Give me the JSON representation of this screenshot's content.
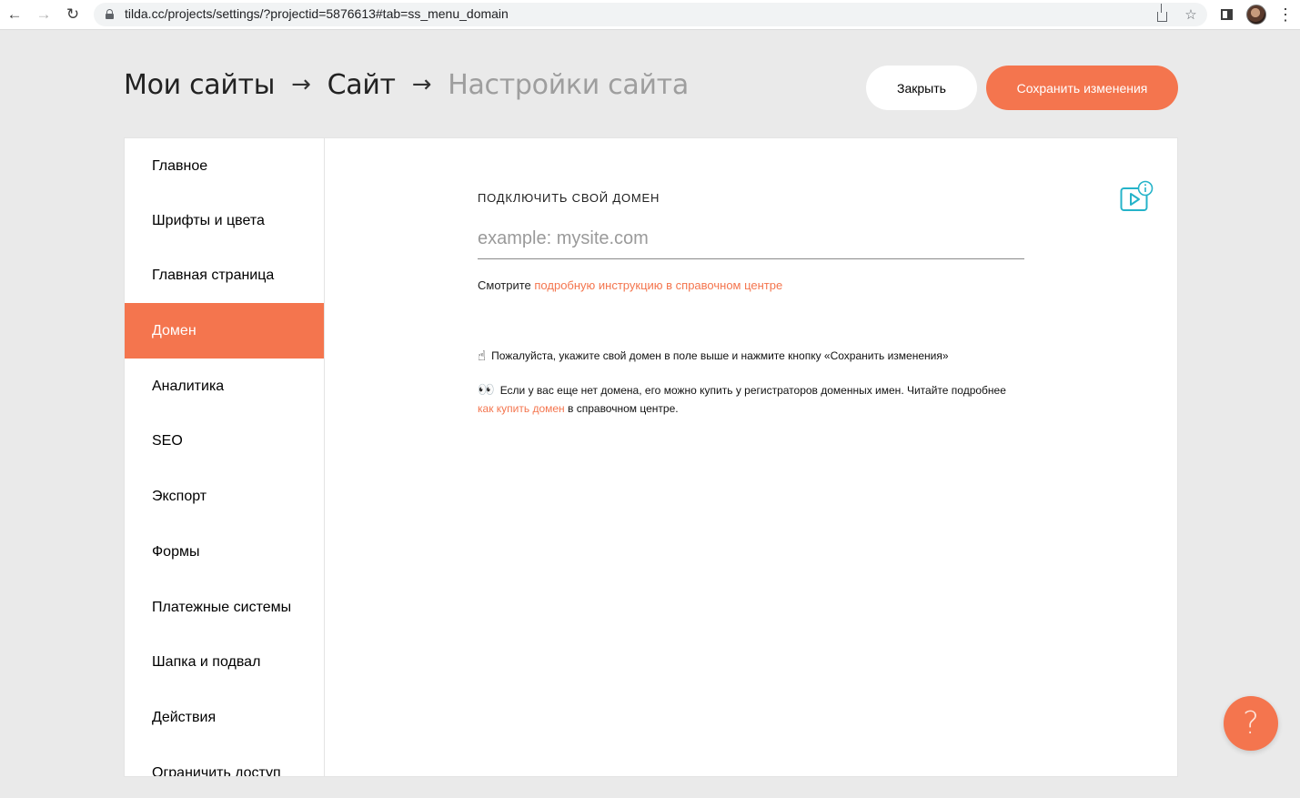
{
  "browser": {
    "url": "tilda.cc/projects/settings/?projectid=5876613#tab=ss_menu_domain",
    "icons": [
      "back-arrow-icon",
      "forward-arrow-icon",
      "reload-icon",
      "lock-icon",
      "share-icon",
      "star-icon",
      "side-panel-icon",
      "profile-avatar",
      "menu-dots-icon"
    ]
  },
  "header": {
    "crumb_1": "Мои сайты",
    "crumb_2": "Сайт",
    "crumb_3": "Настройки сайта",
    "separator": "→",
    "close_label": "Закрыть",
    "save_label": "Сохранить изменения"
  },
  "sidebar": {
    "items": [
      {
        "label": "Главное"
      },
      {
        "label": "Шрифты и цвета"
      },
      {
        "label": "Главная страница"
      },
      {
        "label": "Домен"
      },
      {
        "label": "Аналитика"
      },
      {
        "label": "SEO"
      },
      {
        "label": "Экспорт"
      },
      {
        "label": "Формы"
      },
      {
        "label": "Платежные системы"
      },
      {
        "label": "Шапка и подвал"
      },
      {
        "label": "Действия"
      },
      {
        "label": "Ограничить доступ"
      }
    ],
    "active_index": 3
  },
  "domain": {
    "label": "ПОДКЛЮЧИТЬ СВОЙ ДОМЕН",
    "input_value": "",
    "input_placeholder": "example: mysite.com",
    "help_prefix": "Смотрите",
    "help_link": "подробную инструкцию в справочном центре",
    "note1_emoji": "☝",
    "note1_text": "Пожалуйста, укажите свой домен в поле выше и нажмите кнопку «Сохранить изменения»",
    "note2_emoji": "👀",
    "note2_text": "Если у вас еще нет домена, его можно купить у регистраторов доменных имен. Читайте подробнее",
    "note2_link": "как купить домен",
    "note2_suffix": "в справочном центре."
  },
  "help_fab": {
    "label": "?"
  },
  "colors": {
    "accent": "#f4754e",
    "page_bg": "#eaeaea",
    "teal_icon": "#25b3c9"
  }
}
